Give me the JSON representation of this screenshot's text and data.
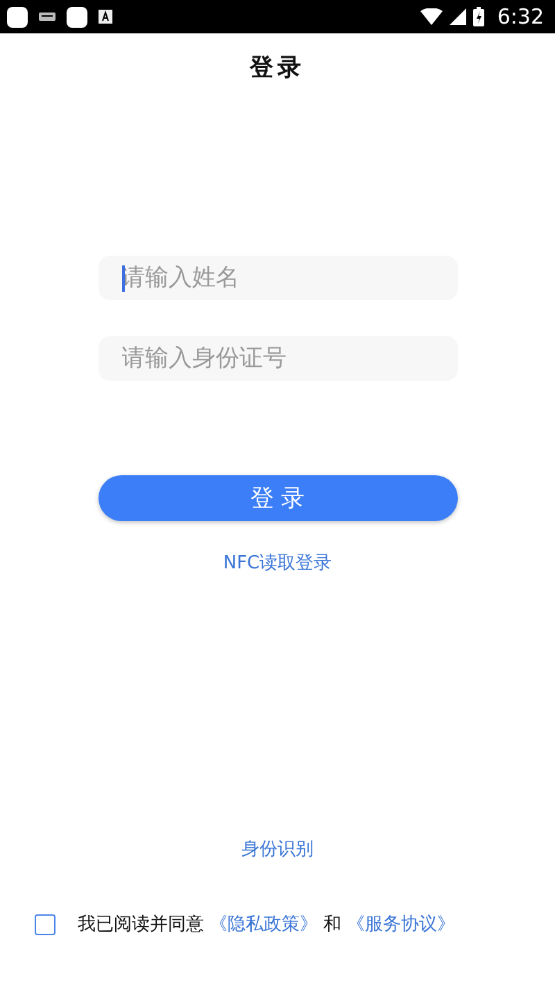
{
  "status_bar": {
    "time": "6:32"
  },
  "title": "登录",
  "fields": [
    {
      "placeholder": "请输入姓名",
      "focused": true
    },
    {
      "placeholder": "请输入身份证号",
      "focused": false
    }
  ],
  "login_button": "登 录",
  "nfc_link": "NFC读取登录",
  "identify_link": "身份识别",
  "agreement": {
    "checked": false,
    "text": "我已阅读并同意",
    "privacy_link": "《隐私政策》",
    "and": "和",
    "service_link": "《服务协议》"
  }
}
